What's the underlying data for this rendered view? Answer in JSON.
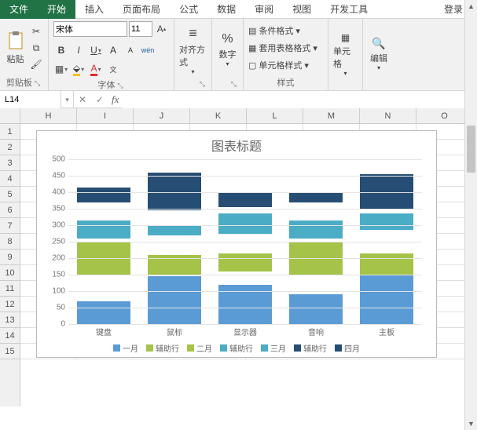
{
  "tabs": {
    "file": "文件",
    "start": "开始",
    "insert": "插入",
    "layout": "页面布局",
    "formula": "公式",
    "data": "数据",
    "review": "审阅",
    "view": "视图",
    "dev": "开发工具",
    "login": "登录"
  },
  "ribbon": {
    "clipboard": {
      "paste": "粘贴",
      "label": "剪贴板"
    },
    "font": {
      "name": "宋体",
      "size": "11",
      "label": "字体",
      "bold": "B",
      "italic": "I",
      "underline": "U",
      "wen": "wén"
    },
    "align": {
      "label": "对齐方式"
    },
    "number": {
      "label": "数字",
      "pct": "%"
    },
    "styles": {
      "cond": "条件格式",
      "table": "套用表格格式",
      "cell": "单元格样式",
      "label": "样式"
    },
    "cells": {
      "label": "单元格"
    },
    "edit": {
      "label": "编辑"
    }
  },
  "namebox": "L14",
  "columns": [
    "H",
    "I",
    "J",
    "K",
    "L",
    "M",
    "N",
    "O"
  ],
  "rows": [
    "1",
    "2",
    "3",
    "4",
    "5",
    "6",
    "7",
    "8",
    "9",
    "10",
    "11",
    "12",
    "13",
    "14",
    "15"
  ],
  "chart_data": {
    "type": "bar",
    "title": "图表标题",
    "ylim": [
      0,
      500
    ],
    "yticks": [
      0,
      50,
      100,
      150,
      200,
      250,
      300,
      350,
      400,
      450,
      500
    ],
    "categories": [
      "键盘",
      "鼠标",
      "显示器",
      "音响",
      "主板"
    ],
    "series": [
      {
        "name": "一月",
        "color": "#5b9bd5",
        "base": [
          0,
          0,
          0,
          0,
          0
        ],
        "values": [
          70,
          145,
          120,
          90,
          155
        ]
      },
      {
        "name": "辅助行",
        "color": "transparent",
        "base": [
          0,
          0,
          0,
          0,
          0
        ],
        "values": [
          0,
          0,
          0,
          0,
          0
        ]
      },
      {
        "name": "二月",
        "color": "#a5c249",
        "base": [
          150,
          150,
          160,
          150,
          150
        ],
        "values": [
          250,
          210,
          215,
          250,
          215
        ]
      },
      {
        "name": "辅助行",
        "color": "transparent",
        "base": [
          0,
          0,
          0,
          0,
          0
        ],
        "values": [
          0,
          0,
          0,
          0,
          0
        ]
      },
      {
        "name": "三月",
        "color": "#4bacc6",
        "base": [
          260,
          270,
          275,
          260,
          285
        ],
        "values": [
          315,
          300,
          335,
          315,
          335
        ]
      },
      {
        "name": "辅助行",
        "color": "transparent",
        "base": [
          0,
          0,
          0,
          0,
          0
        ],
        "values": [
          0,
          0,
          0,
          0,
          0
        ]
      },
      {
        "name": "四月",
        "color": "#264d73",
        "base": [
          370,
          345,
          355,
          370,
          350
        ],
        "values": [
          415,
          460,
          400,
          400,
          455
        ]
      }
    ],
    "legend": [
      "一月",
      "辅助行",
      "二月",
      "辅助行",
      "三月",
      "辅助行",
      "四月"
    ],
    "legend_colors": [
      "#5b9bd5",
      "#a5c249",
      "#a5c249",
      "#4bacc6",
      "#4bacc6",
      "#264d73",
      "#264d73"
    ]
  }
}
